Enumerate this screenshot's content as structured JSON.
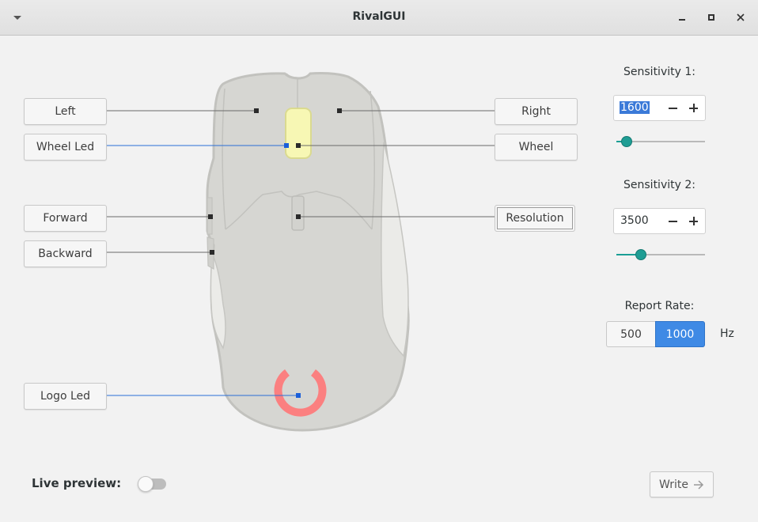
{
  "window": {
    "title": "RivalGUI"
  },
  "buttons": {
    "left": "Left",
    "right": "Right",
    "wheel_led": "Wheel Led",
    "wheel": "Wheel",
    "forward": "Forward",
    "resolution": "Resolution",
    "backward": "Backward",
    "logo_led": "Logo Led"
  },
  "sensitivity1": {
    "label": "Sensitivity 1:",
    "value": "1600",
    "slider_fraction": 0.12
  },
  "sensitivity2": {
    "label": "Sensitivity 2:",
    "value": "3500",
    "slider_fraction": 0.28
  },
  "report_rate": {
    "label": "Report Rate:",
    "options": [
      "500",
      "1000"
    ],
    "selected": "1000",
    "unit": "Hz"
  },
  "live_preview": {
    "label": "Live preview:",
    "enabled": false
  },
  "write_button": {
    "label": "Write"
  },
  "colors": {
    "wheel_led": "#f7f7b4",
    "logo_led": "#fb8080",
    "accent": "#3f8ae5",
    "slider": "#1f9d94",
    "active_line": "#2b6fd6"
  }
}
